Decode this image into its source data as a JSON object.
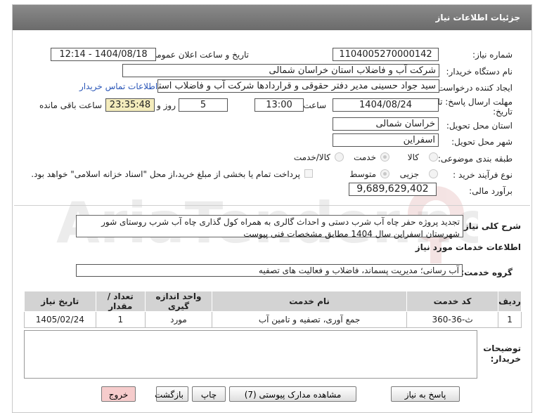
{
  "header": {
    "title": "جزئیات اطلاعات نیاز"
  },
  "fields": {
    "need_number_label": "شماره نیاز:",
    "need_number": "1104005270000142",
    "announce_label": "تاریخ و ساعت اعلان عمومی:",
    "announce_value": "1404/08/18 - 12:14",
    "buyer_org_label": "نام دستگاه خریدار:",
    "buyer_org": "شرکت آب و فاضلاب استان خراسان شمالی",
    "requester_label": "ایجاد کننده درخواست:",
    "requester": "سید جواد حسینی مدیر دفتر حقوقی و قراردادها  شرکت آب و فاضلاب استان خراسان شمالی",
    "buyer_contact_link": "اطلاعات تماس خریدار",
    "deadline_label_1": "مهلت ارسال پاسخ: تا",
    "deadline_label_2": "تاریخ:",
    "deadline_date": "1404/08/24",
    "time_label": "ساعت",
    "deadline_time": "13:00",
    "days": "5",
    "days_label": "روز و",
    "remaining_time": "23:35:48",
    "remaining_label": "ساعت باقی مانده",
    "province_label": "استان محل تحویل:",
    "province": "خراسان شمالی",
    "city_label": "شهر محل تحویل:",
    "city": "اسفراین",
    "category_label": "طبقه بندی موضوعی:",
    "category_options": [
      "کالا",
      "خدمت",
      "کالا/خدمت"
    ],
    "category_selected": "خدمت",
    "process_label": "نوع فرآیند خرید :",
    "process_options": [
      "جزیی",
      "متوسط"
    ],
    "process_selected": "متوسط",
    "payment_note": "پرداخت تمام یا بخشی از مبلغ خرید،از محل \"اسناد خزانه اسلامی\" خواهد بود.",
    "estimate_label": "برآورد مالی:",
    "estimate": "9,689,629,402"
  },
  "description": {
    "label": "شرح کلی نیاز:",
    "text": "تجدید پروژه حفر چاه آب شرب دستی و احداث گالری به همراه کول گذاری چاه آب شرب روستای شور شهرستان اسفراین سال 1404 مطابق مشخصات فنی پیوست"
  },
  "services": {
    "section_title": "اطلاعات خدمات مورد نیاز",
    "group_label": "گروه خدمت:",
    "group_value": "آب رسانی؛ مدیریت پسماند، فاضلاب و فعالیت های تصفیه"
  },
  "table": {
    "headers": [
      "ردیف",
      "کد خدمت",
      "نام خدمت",
      "واحد اندازه گیری",
      "تعداد / مقدار",
      "تاریخ نیاز"
    ],
    "rows": [
      [
        "1",
        "ث-36-360",
        "جمع آوری، تصفیه و تامین آب",
        "مورد",
        "1",
        "1405/02/24"
      ]
    ]
  },
  "buyer_notes": {
    "label_1": "توضیحات",
    "label_2": "خریدار:",
    "text": ""
  },
  "buttons": {
    "reply": "پاسخ به نیاز",
    "attachments": "مشاهده مدارک پیوستی (7)",
    "print": "چاپ",
    "back": "بازگشت",
    "exit": "خروج"
  },
  "watermark": "AriaTender.neT",
  "colors": {
    "title_bar": "#7a7a7a",
    "link": "#2a56b8",
    "remaining_bg": "#f4ecbc",
    "exit_bg": "#f6cccc",
    "table_header": "#d3d3d3"
  }
}
